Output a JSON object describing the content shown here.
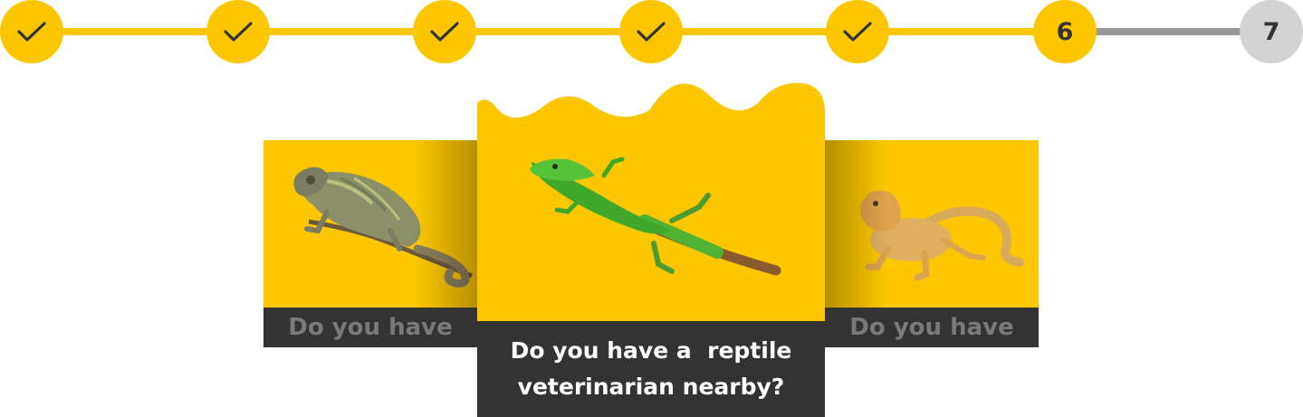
{
  "stepper": {
    "steps": [
      {
        "state": "complete",
        "label": ""
      },
      {
        "state": "complete",
        "label": ""
      },
      {
        "state": "complete",
        "label": ""
      },
      {
        "state": "complete",
        "label": ""
      },
      {
        "state": "complete",
        "label": ""
      },
      {
        "state": "current",
        "label": "6"
      },
      {
        "state": "upcoming",
        "label": "7"
      }
    ],
    "icons": {
      "complete": "check-icon"
    },
    "colors": {
      "accent": "#fdc700",
      "track_done": "#fdc700",
      "track_todo": "#979797",
      "upcoming": "#d3d3d3"
    }
  },
  "carousel": {
    "left_card": {
      "caption": "Do you have",
      "animal": "chameleon"
    },
    "center_card": {
      "caption": "Do you have a  reptile veterinarian nearby?",
      "animal": "green-lizard"
    },
    "right_card": {
      "caption": "Do you have",
      "animal": "bearded-dragon"
    },
    "colors": {
      "card_bg": "#fdc700",
      "caption_bg": "#333333",
      "caption_text": "#ffffff",
      "caption_text_dim": "#7a7a7a"
    }
  }
}
